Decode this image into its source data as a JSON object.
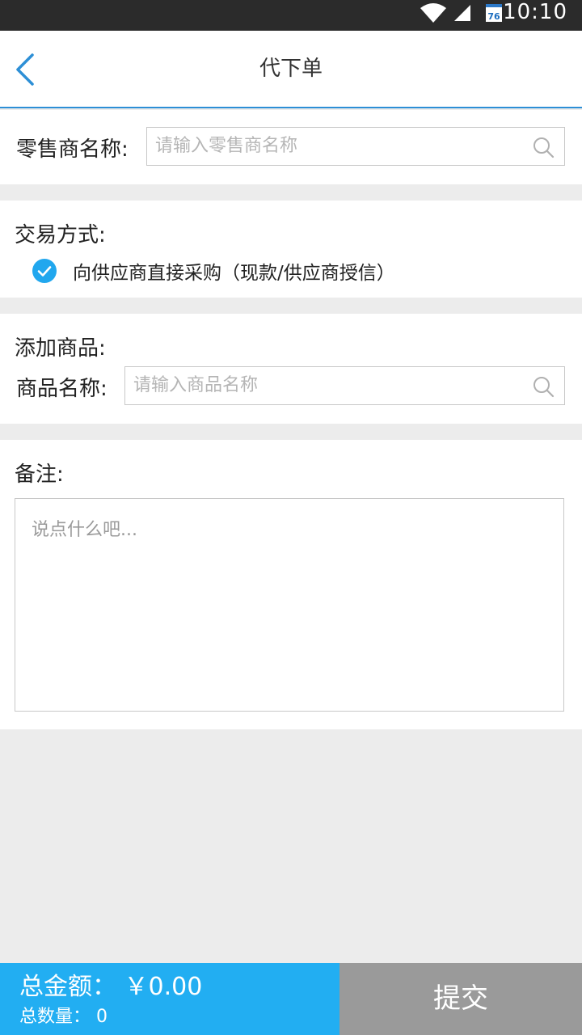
{
  "status_bar": {
    "time": "10:10",
    "calendar_day": "76"
  },
  "header": {
    "title": "代下单"
  },
  "retailer": {
    "label": "零售商名称:",
    "placeholder": "请输入零售商名称"
  },
  "trade": {
    "label": "交易方式:",
    "option_label": "向供应商直接采购（现款/供应商授信）",
    "option_checked": true
  },
  "goods": {
    "section_label": "添加商品:",
    "name_label": "商品名称:",
    "placeholder": "请输入商品名称"
  },
  "remark": {
    "label": "备注:",
    "placeholder": "说点什么吧..."
  },
  "footer": {
    "total_amount_label": "总金额：",
    "total_amount_value": "￥0.00",
    "total_qty_label": "总数量：",
    "total_qty_value": "0",
    "submit_label": "提交"
  },
  "colors": {
    "accent": "#22aef2",
    "submit_bg": "#9a9a9a",
    "header_line": "#2d8fd6",
    "page_bg": "#ececec"
  }
}
